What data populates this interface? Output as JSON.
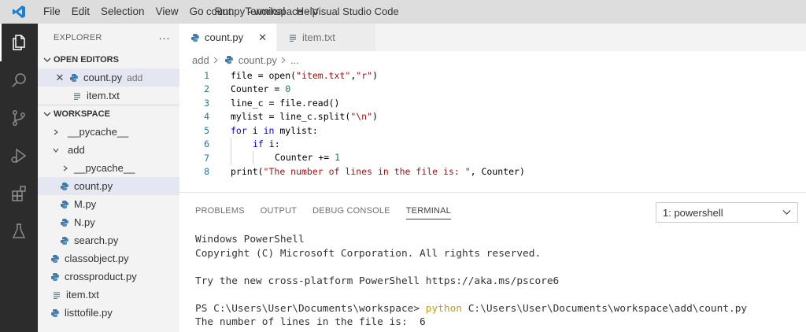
{
  "titlebar": {
    "menu": [
      "File",
      "Edit",
      "Selection",
      "View",
      "Go",
      "Run",
      "Terminal",
      "Help"
    ],
    "window_title": "count.py - workspace - Visual Studio Code"
  },
  "activitybar": {
    "items": [
      "explorer-icon",
      "search-icon",
      "source-control-icon",
      "run-debug-icon",
      "extensions-icon",
      "testing-icon"
    ]
  },
  "sidebar": {
    "title": "EXPLORER",
    "more": "···",
    "open_editors": {
      "header": "OPEN EDITORS",
      "items": [
        {
          "name": "count.py",
          "badge": "add"
        },
        {
          "name": "item.txt"
        }
      ]
    },
    "workspace": {
      "header": "WORKSPACE",
      "items": [
        {
          "name": "__pycache__"
        },
        {
          "name": "add"
        },
        {
          "name": "__pycache__"
        },
        {
          "name": "count.py"
        },
        {
          "name": "M.py"
        },
        {
          "name": "N.py"
        },
        {
          "name": "search.py"
        },
        {
          "name": "classobject.py"
        },
        {
          "name": "crossproduct.py"
        },
        {
          "name": "item.txt"
        },
        {
          "name": "listtofile.py"
        }
      ]
    }
  },
  "editor": {
    "tabs": [
      {
        "label": "count.py",
        "close": "✕"
      },
      {
        "label": "item.txt"
      }
    ],
    "breadcrumb": {
      "folder": "add",
      "file": "count.py",
      "more": "..."
    },
    "line_numbers": [
      "1",
      "2",
      "3",
      "4",
      "5",
      "6",
      "7",
      "8"
    ],
    "code": {
      "l1": [
        "file = open(",
        "\"item.txt\"",
        ",",
        "\"r\"",
        ")"
      ],
      "l2": [
        "Counter = ",
        "0"
      ],
      "l3": [
        "line_c = file.read()"
      ],
      "l4": [
        "mylist = line_c.split(",
        "\"\\n\"",
        ")"
      ],
      "l5": [
        "for",
        " i ",
        "in",
        " mylist:"
      ],
      "l6": [
        "if",
        " i:"
      ],
      "l7": [
        "Counter += ",
        "1"
      ],
      "l8": [
        "print(",
        "\"The number of lines in the file is: \"",
        ", Counter)"
      ]
    }
  },
  "panel": {
    "tabs": [
      "PROBLEMS",
      "OUTPUT",
      "DEBUG CONSOLE",
      "TERMINAL"
    ],
    "terminal_select": "1: powershell",
    "terminal": {
      "l1": "Windows PowerShell",
      "l2": "Copyright (C) Microsoft Corporation. All rights reserved.",
      "l3": "Try the new cross-platform PowerShell https://aka.ms/pscore6",
      "prompt": "PS C:\\Users\\User\\Documents\\workspace> ",
      "cmd": "python",
      "args": " C:\\Users\\User\\Documents\\workspace\\add\\count.py",
      "output": "The number of lines in the file is:  6"
    }
  }
}
